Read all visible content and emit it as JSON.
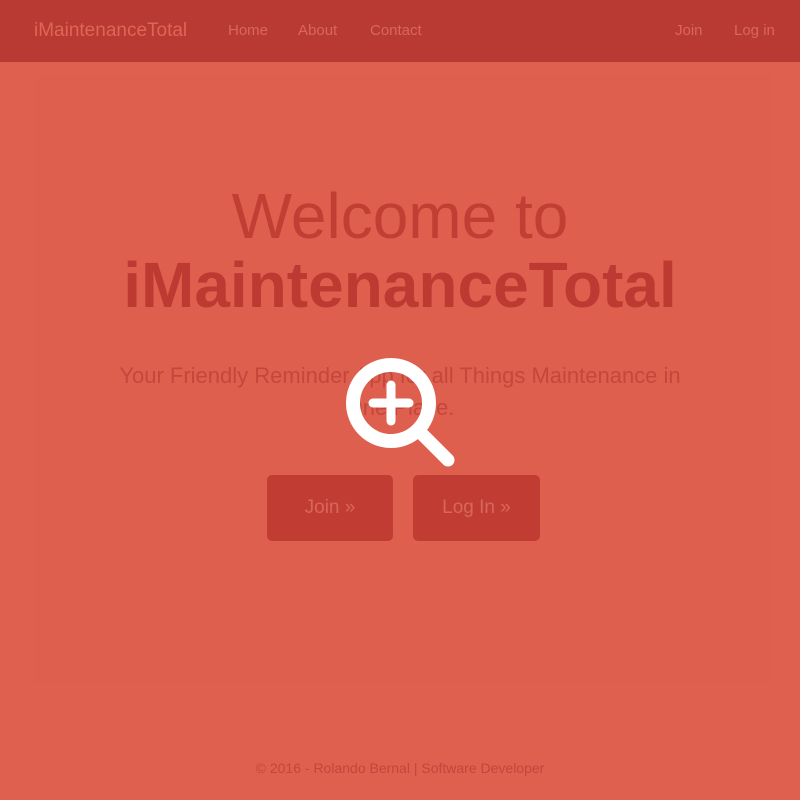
{
  "navbar": {
    "brand": "iMaintenanceTotal",
    "links": [
      "Home",
      "About",
      "Contact"
    ],
    "right_links": [
      "Join",
      "Log in"
    ]
  },
  "hero": {
    "title_line1": "Welcome to",
    "title_line2": "iMaintenanceTotal",
    "tagline": "Your Friendly Reminder App for all Things Maintenance in One Place.",
    "buttons": [
      "Join »",
      "Log In »"
    ]
  },
  "footer": {
    "text": "© 2016 - Rolando Bernal | Software Developer"
  },
  "overlay": {
    "icon": "zoom-in-icon"
  },
  "colors": {
    "background": "#e06050",
    "navbar": "#b93a32",
    "button": "#c13c33"
  }
}
